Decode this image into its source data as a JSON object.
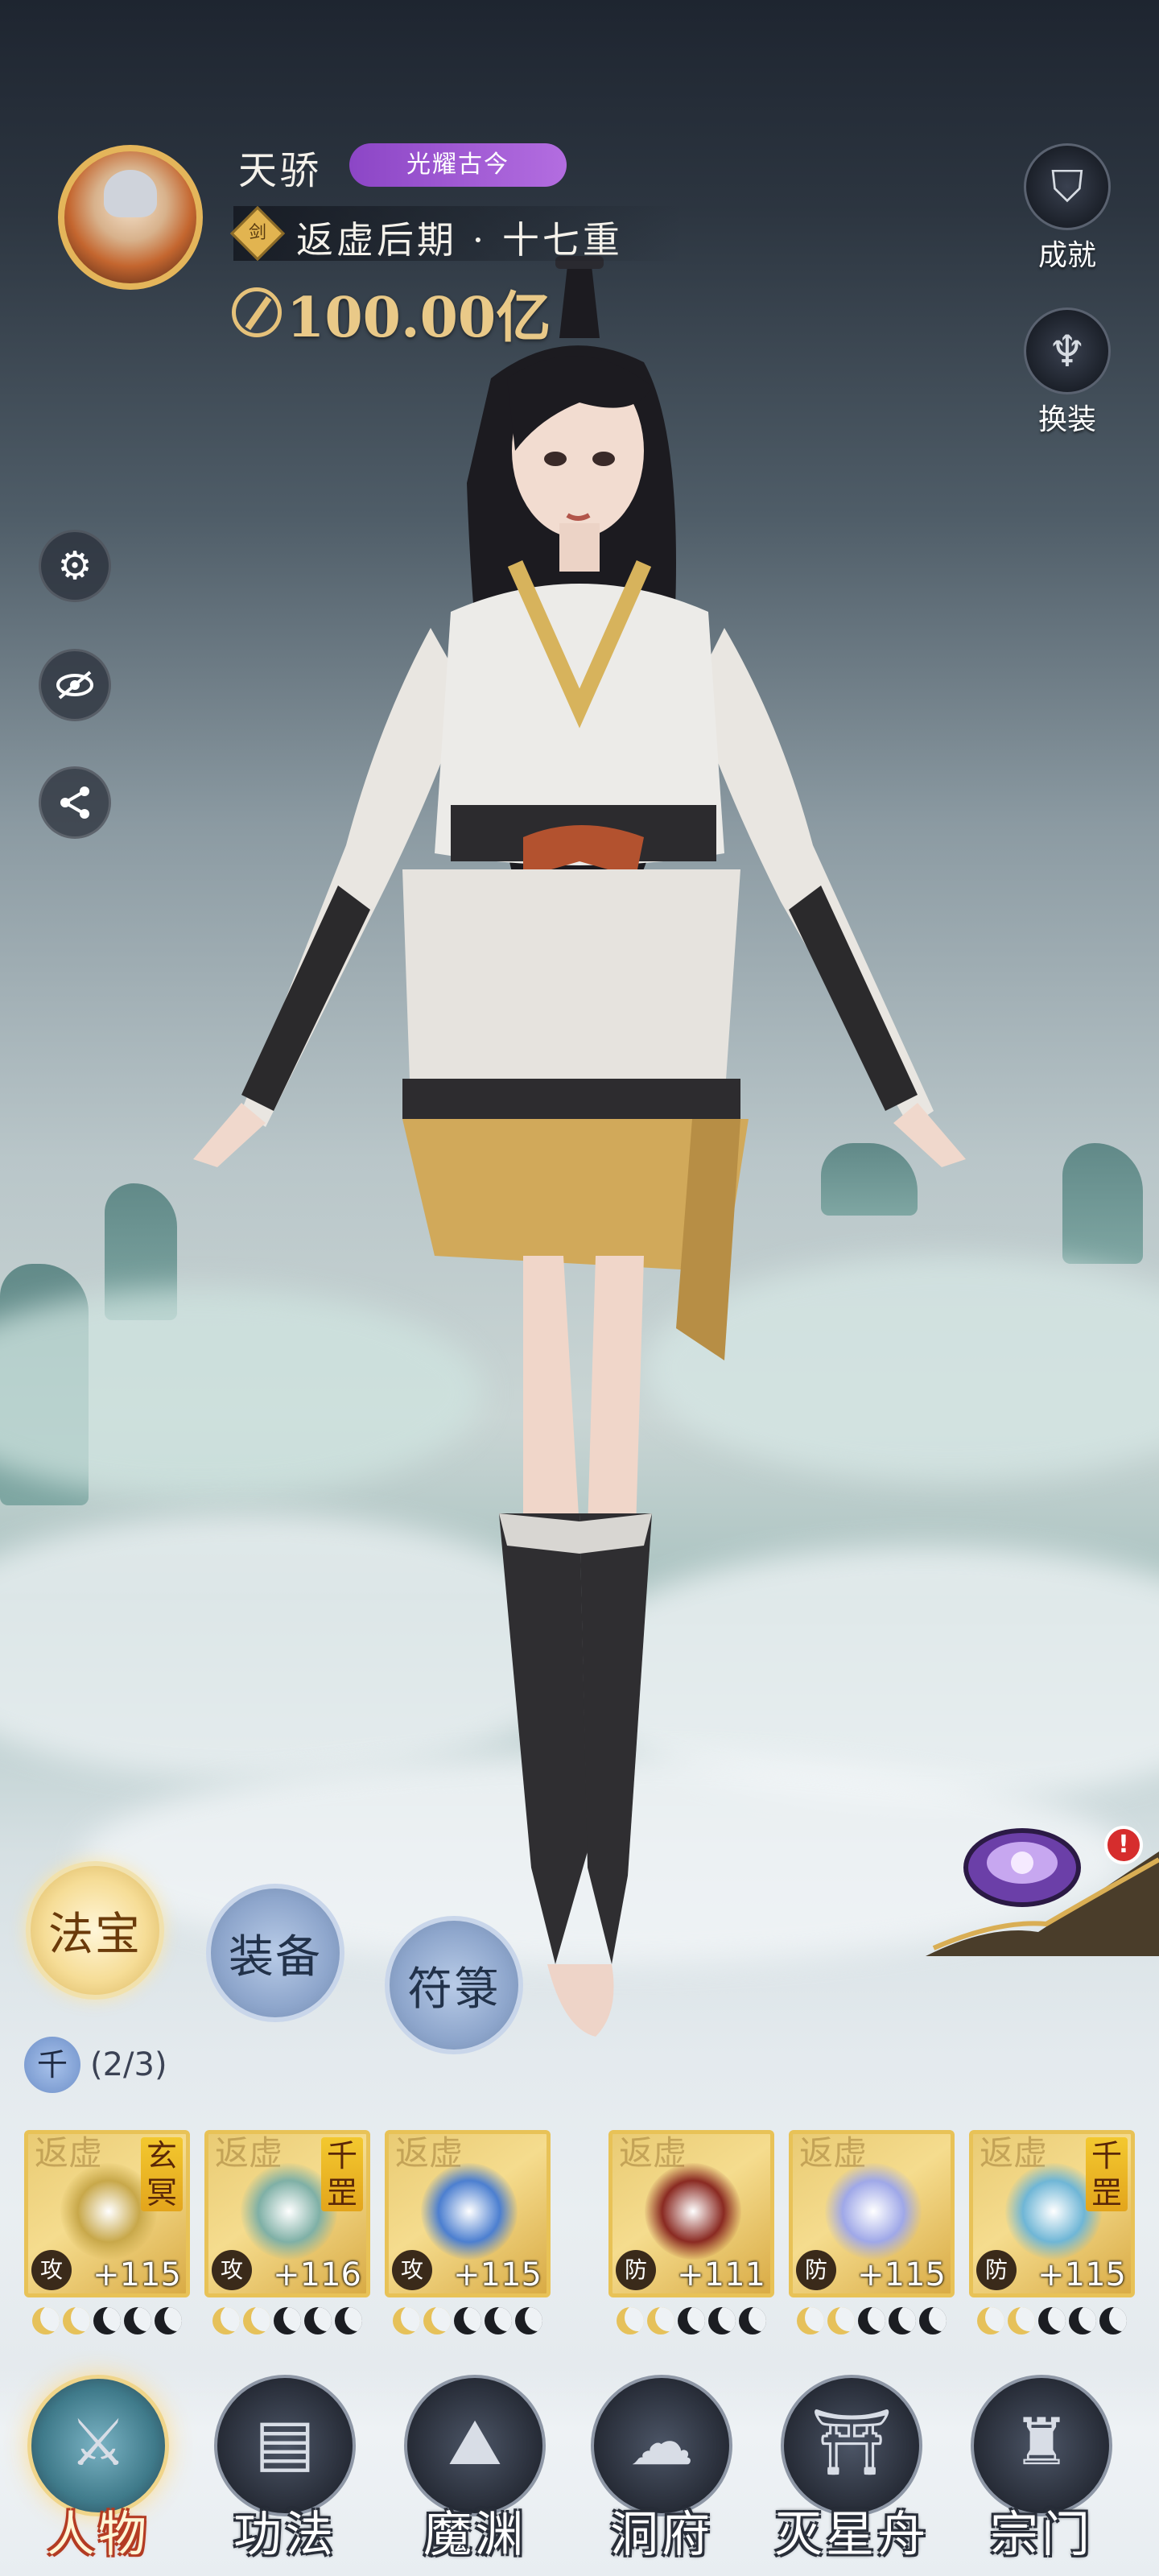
{
  "header": {
    "player_name": "天骄",
    "title_badge": "光耀古今",
    "realm_icon_char": "剑",
    "realm": "返虚后期 · 十七重",
    "combat_power": "100.00亿"
  },
  "right_buttons": [
    {
      "label": "成就",
      "icon": "shield-achievement-icon"
    },
    {
      "label": "换装",
      "icon": "armor-outfit-icon"
    }
  ],
  "left_buttons": [
    {
      "icon": "gear-icon"
    },
    {
      "icon": "eye-hidden-icon"
    },
    {
      "icon": "share-icon"
    }
  ],
  "tabs": [
    {
      "label": "法宝",
      "active": true
    },
    {
      "label": "装备",
      "active": false
    },
    {
      "label": "符箓",
      "active": false
    }
  ],
  "set": {
    "icon_char": "千",
    "count": "(2/3)"
  },
  "items": [
    {
      "ghost": "返虚",
      "tag": "玄冥",
      "kind": "攻",
      "bonus": "+115",
      "stars_lit": 2,
      "stars_total": 5,
      "art_color": "#c8a84a"
    },
    {
      "ghost": "返虚",
      "tag": "千罡",
      "kind": "攻",
      "bonus": "+116",
      "stars_lit": 2,
      "stars_total": 5,
      "art_color": "#7fb0a6"
    },
    {
      "ghost": "返虚",
      "tag": "",
      "kind": "攻",
      "bonus": "+115",
      "stars_lit": 2,
      "stars_total": 5,
      "art_color": "#4c7fd0"
    },
    {
      "ghost": "返虚",
      "tag": "",
      "kind": "防",
      "bonus": "+111",
      "stars_lit": 2,
      "stars_total": 5,
      "art_color": "#8a2a22"
    },
    {
      "ghost": "返虚",
      "tag": "",
      "kind": "防",
      "bonus": "+115",
      "stars_lit": 2,
      "stars_total": 5,
      "art_color": "#9fa8e8"
    },
    {
      "ghost": "返虚",
      "tag": "千罡",
      "kind": "防",
      "bonus": "+115",
      "stars_lit": 2,
      "stars_total": 5,
      "art_color": "#6fb6d6"
    }
  ],
  "alert_mark": "!",
  "bottom_nav": [
    {
      "label": "人物",
      "active": true,
      "icon": "character-icon"
    },
    {
      "label": "功法",
      "active": false,
      "icon": "scroll-cards-icon"
    },
    {
      "label": "魔渊",
      "active": false,
      "icon": "abyss-mountain-icon"
    },
    {
      "label": "洞府",
      "active": false,
      "icon": "cave-dwelling-icon"
    },
    {
      "label": "灭星舟",
      "active": false,
      "icon": "star-ship-icon"
    },
    {
      "label": "宗门",
      "active": false,
      "icon": "sect-pagoda-icon"
    }
  ]
}
